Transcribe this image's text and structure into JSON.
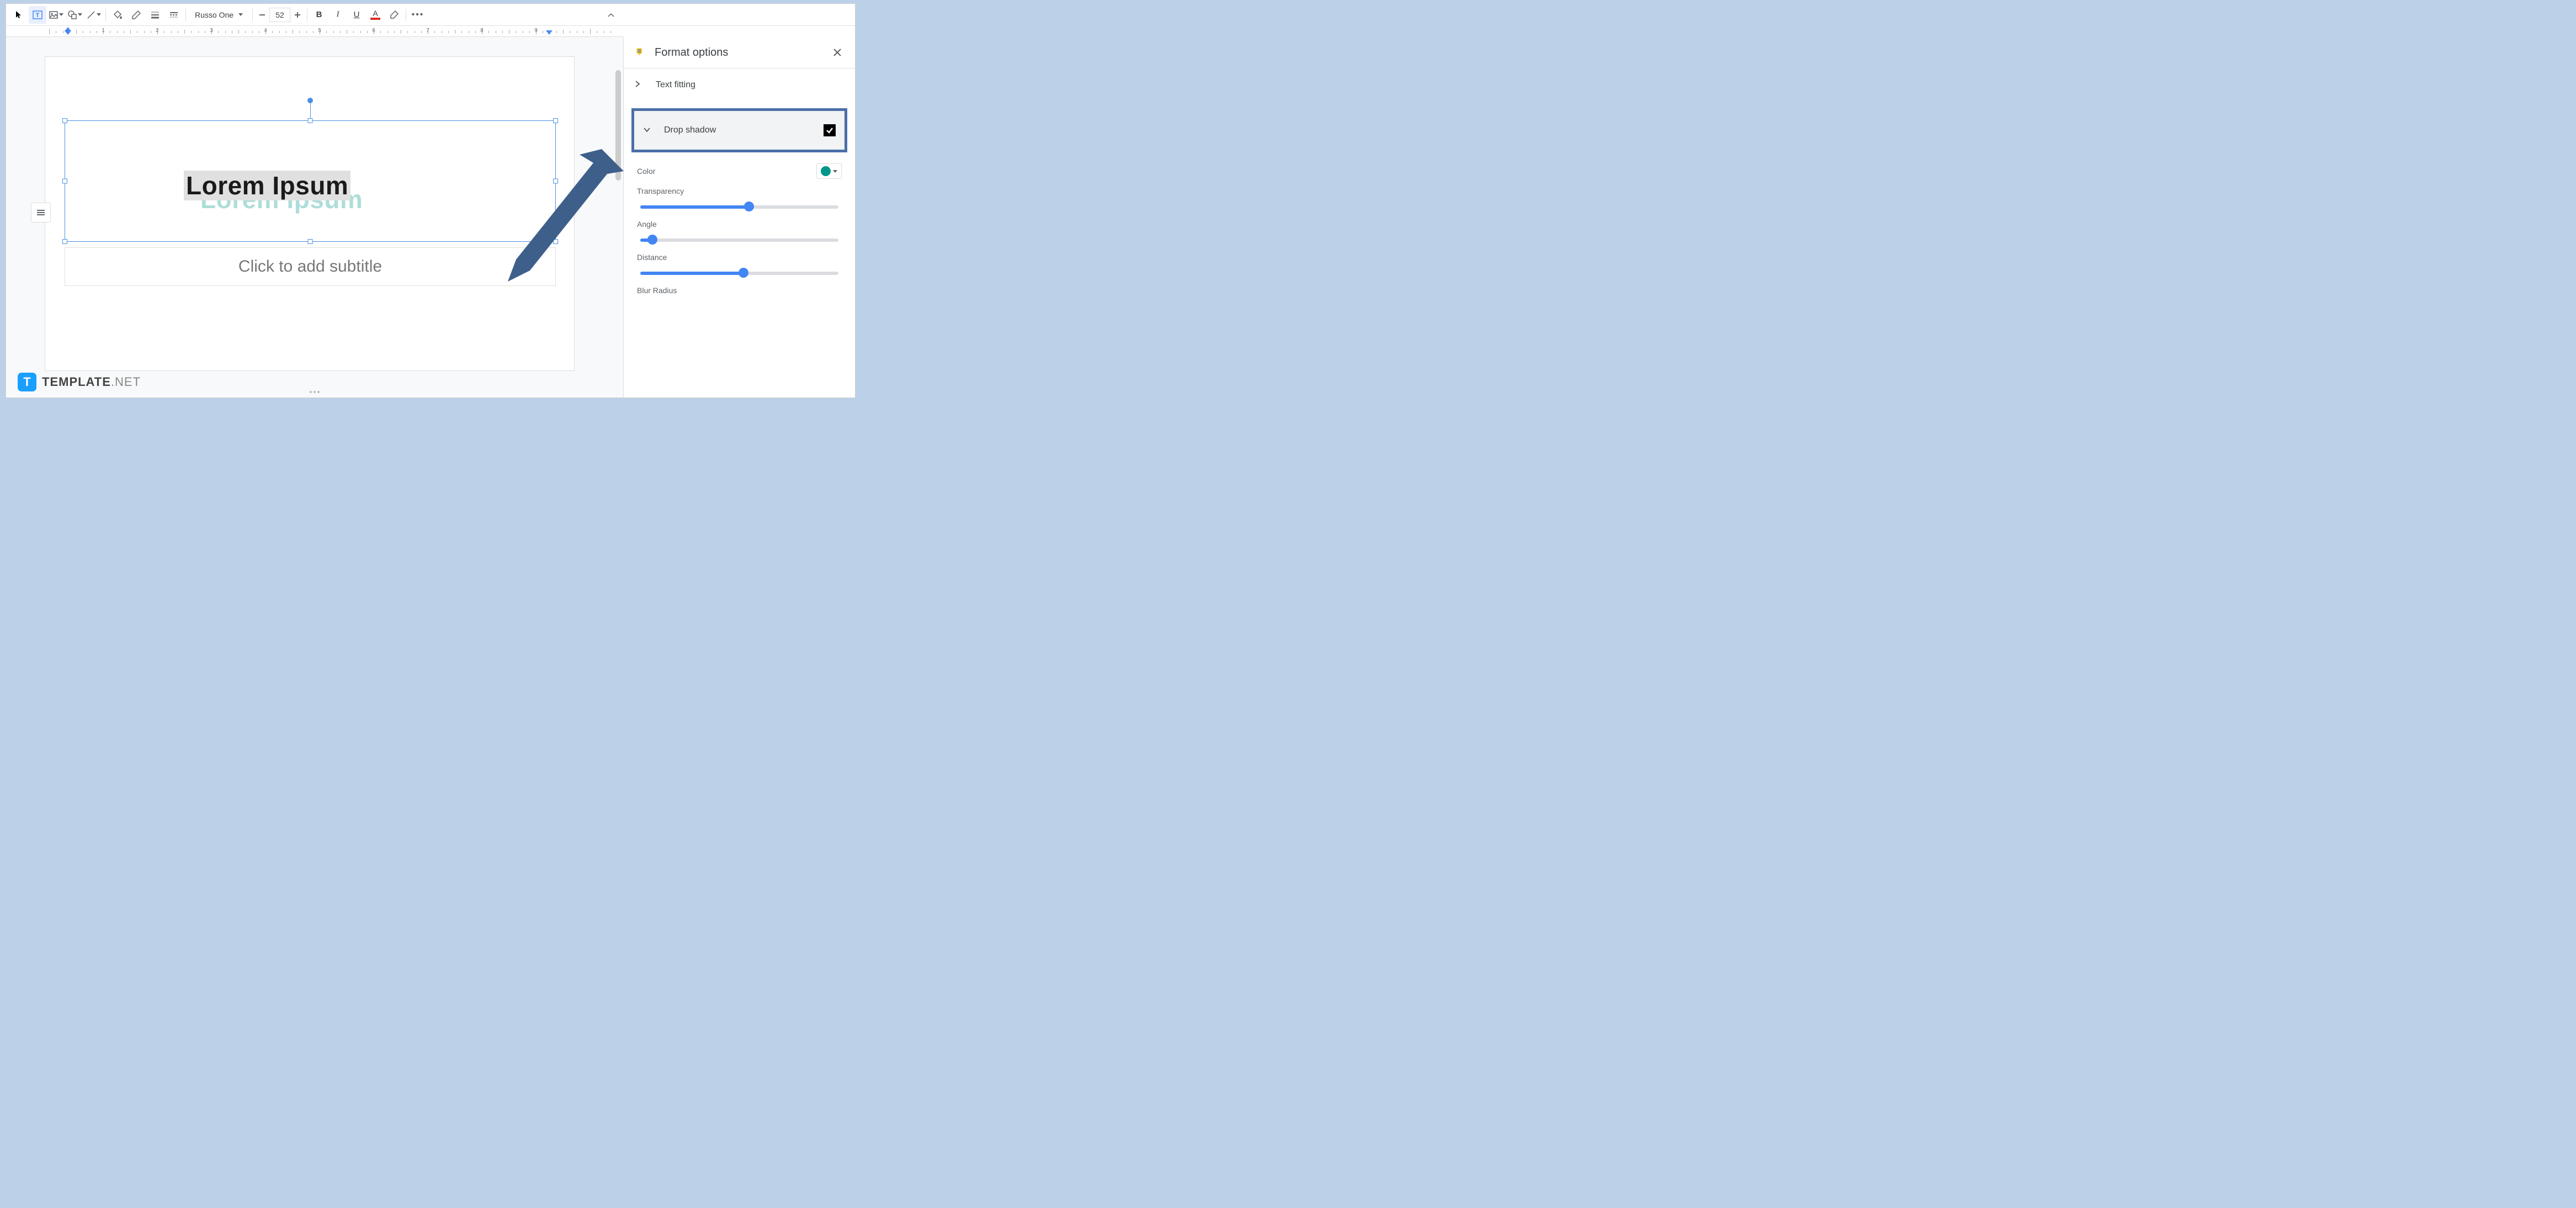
{
  "toolbar": {
    "font_name": "Russo One",
    "font_size": "52",
    "bold": "B",
    "italic": "I",
    "underline": "U",
    "text_color_letter": "A"
  },
  "ruler": {
    "marks": [
      "1",
      "2",
      "3",
      "4",
      "5",
      "6",
      "7",
      "8",
      "9"
    ]
  },
  "slide": {
    "title_text": "Lorem Ipsum",
    "subtitle_placeholder": "Click to add subtitle"
  },
  "sidebar": {
    "title": "Format options",
    "sections": {
      "text_fitting": "Text fitting",
      "drop_shadow": "Drop shadow",
      "drop_shadow_checked": true,
      "color_label": "Color",
      "transparency_label": "Transparency",
      "angle_label": "Angle",
      "distance_label": "Distance",
      "blur_label": "Blur Radius"
    },
    "sliders": {
      "transparency_pct": 55,
      "angle_pct": 6,
      "distance_pct": 52
    },
    "color_swatch": "#009688"
  },
  "watermark": {
    "icon_letter": "T",
    "bold": "TEMPLATE",
    "light": ".NET"
  }
}
